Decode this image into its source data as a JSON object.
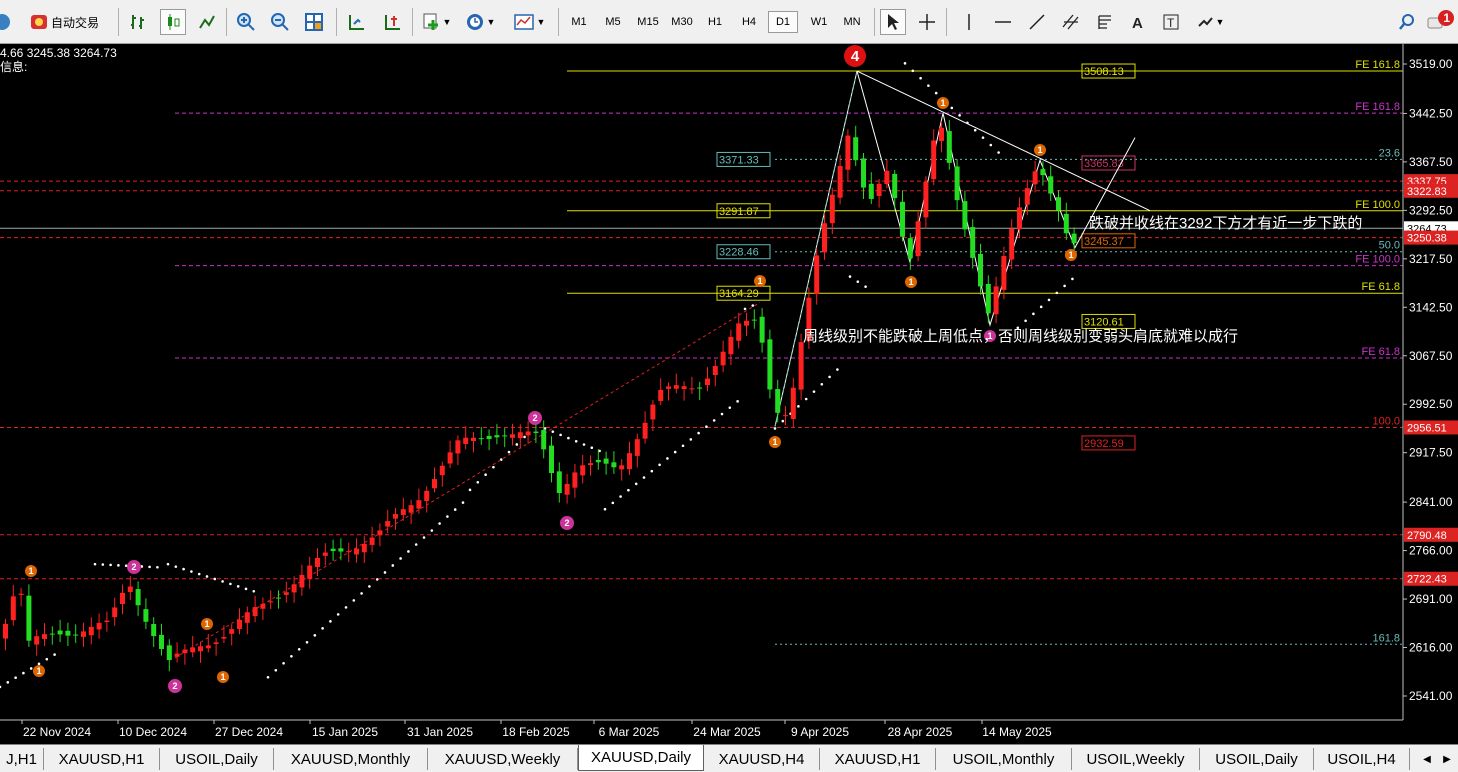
{
  "toolbar": {
    "autotrade_label": "自动交易",
    "timeframes": [
      "M1",
      "M5",
      "M15",
      "M30",
      "H1",
      "H4",
      "D1",
      "W1",
      "MN"
    ],
    "active_timeframe": "D1",
    "notification_count": "1"
  },
  "chart": {
    "symbol": "XAUUSD",
    "timeframe": "Daily",
    "ohlc_text": "4.66 3245.38 3264.73",
    "info_text": "信息:",
    "price_axis_labels": [
      "3519.00",
      "3442.50",
      "3367.50",
      "3292.50",
      "3217.50",
      "3142.50",
      "3067.50",
      "2992.50",
      "2917.50",
      "2841.00",
      "2766.00",
      "2691.00",
      "2616.00",
      "2541.00"
    ],
    "date_axis_labels": [
      "22 Nov 2024",
      "10 Dec 2024",
      "27 Dec 2024",
      "15 Jan 2025",
      "31 Jan 2025",
      "18 Feb 2025",
      "6 Mar 2025",
      "24 Mar 2025",
      "9 Apr 2025",
      "28 Apr 2025",
      "14 May 2025"
    ],
    "horizontal_levels": [
      {
        "price": 3508.13,
        "label": "3508.13",
        "right_label": "FE 161.8",
        "color": "#e0e000",
        "style": "solid"
      },
      {
        "price": 3443,
        "right_label": "FE 161.8",
        "color": "#cc33cc",
        "style": "dashed"
      },
      {
        "price": 3371.33,
        "label": "3371.33",
        "right_label": "23.6",
        "color": "#66bbbb",
        "style": "dotted"
      },
      {
        "price": 3365.83,
        "label": "3365.83",
        "color": "#cc3366",
        "style": "none"
      },
      {
        "price": 3337.75,
        "tag": "3337.75",
        "color": "#dd2222",
        "style": "dashed"
      },
      {
        "price": 3322.83,
        "tag": "3322.83",
        "color": "#dd2222",
        "style": "dashed"
      },
      {
        "price": 3291.87,
        "label": "3291.87",
        "right_label": "FE 100.0",
        "color": "#e0e000",
        "style": "solid"
      },
      {
        "price": 3264.73,
        "tag": "3264.73",
        "color": "#99aaaa",
        "style": "solid"
      },
      {
        "price": 3250.38,
        "tag": "3250.38",
        "color": "#dd2222",
        "style": "dashed"
      },
      {
        "price": 3245.37,
        "label": "3245.37",
        "color": "#dd6600",
        "style": "none"
      },
      {
        "price": 3228.46,
        "label": "3228.46",
        "right_label": "50.0",
        "color": "#66bbbb",
        "style": "dotted"
      },
      {
        "price": 3207,
        "right_label": "FE 100.0",
        "color": "#cc33cc",
        "style": "dashed"
      },
      {
        "price": 3164.29,
        "label": "3164.29",
        "right_label": "FE 61.8",
        "color": "#e0e000",
        "style": "solid"
      },
      {
        "price": 3120.61,
        "label": "3120.61",
        "color": "#e0e000",
        "style": "none"
      },
      {
        "price": 3064,
        "right_label": "FE 61.8",
        "color": "#cc33cc",
        "style": "dashed"
      },
      {
        "price": 2956.51,
        "tag": "2956.51",
        "right_label": "100.0",
        "color": "#dd2222",
        "style": "dashed"
      },
      {
        "price": 2932.59,
        "label": "2932.59",
        "color": "#dd2222",
        "style": "none"
      },
      {
        "price": 2790.48,
        "tag": "2790.48",
        "color": "#dd2222",
        "style": "dashed"
      },
      {
        "price": 2722.43,
        "tag": "2722.43",
        "color": "#dd2222",
        "style": "dashed"
      },
      {
        "price": 2621,
        "right_label": "161.8",
        "color": "#66bbbb",
        "style": "dotted"
      }
    ],
    "annotations": [
      {
        "text": "跌破并收线在3292下方才有近一步下跌的",
        "color": "#ffffff"
      },
      {
        "text": "周线级别不能跌破上周低点，否则周线级别变弱头肩底就难以成行",
        "color": "#ffffff"
      }
    ],
    "wave_labels": [
      "4",
      "1",
      "1",
      "1",
      "1",
      "1",
      "1",
      "1",
      "2",
      "2",
      "2",
      "2",
      "1",
      "1",
      "1",
      "1"
    ]
  },
  "tabs": {
    "items": [
      "J,H1",
      "XAUUSD,H1",
      "USOIL,Daily",
      "XAUUSD,Monthly",
      "XAUUSD,Weekly",
      "XAUUSD,Daily",
      "XAUUSD,H4",
      "XAUUSD,H1",
      "USOIL,Monthly",
      "USOIL,Weekly",
      "USOIL,Daily",
      "USOIL,H4"
    ],
    "active_index": 5
  },
  "colors": {
    "bull": "#ff2020",
    "bear": "#22dd22",
    "background": "#000000"
  }
}
